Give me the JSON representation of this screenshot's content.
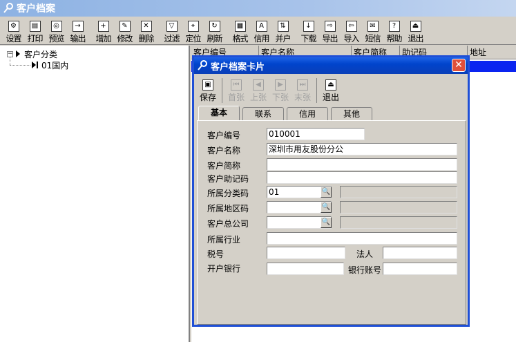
{
  "window": {
    "title": "客户档案"
  },
  "toolbar": {
    "buttons": [
      {
        "label": "设置",
        "icon": "settings-icon"
      },
      {
        "label": "打印",
        "icon": "printer-icon"
      },
      {
        "label": "预览",
        "icon": "preview-icon"
      },
      {
        "label": "输出",
        "icon": "export-icon"
      },
      {
        "label": "增加",
        "icon": "add-icon"
      },
      {
        "label": "修改",
        "icon": "edit-icon"
      },
      {
        "label": "删除",
        "icon": "delete-icon"
      },
      {
        "label": "过滤",
        "icon": "filter-icon"
      },
      {
        "label": "定位",
        "icon": "locate-icon"
      },
      {
        "label": "刷新",
        "icon": "refresh-icon"
      },
      {
        "label": "格式",
        "icon": "format-icon"
      },
      {
        "label": "信用",
        "icon": "credit-icon"
      },
      {
        "label": "并户",
        "icon": "merge-icon"
      },
      {
        "label": "下载",
        "icon": "download-icon"
      },
      {
        "label": "导出",
        "icon": "export-out-icon"
      },
      {
        "label": "导入",
        "icon": "import-icon"
      },
      {
        "label": "短信",
        "icon": "sms-icon"
      },
      {
        "label": "帮助",
        "icon": "help-icon"
      },
      {
        "label": "退出",
        "icon": "exit-icon"
      }
    ]
  },
  "tree": {
    "root": "客户分类",
    "child": "01国内"
  },
  "grid": {
    "columns": [
      "客户编号",
      "客户名称",
      "客户简称",
      "助记码",
      "地址"
    ]
  },
  "dialog": {
    "title": "客户档案卡片",
    "close_glyph": "✕",
    "toolbar": [
      {
        "label": "保存",
        "enabled": true,
        "icon": "save-icon"
      },
      {
        "label": "首张",
        "enabled": false,
        "icon": "first-icon"
      },
      {
        "label": "上张",
        "enabled": false,
        "icon": "prev-icon"
      },
      {
        "label": "下张",
        "enabled": false,
        "icon": "next-icon"
      },
      {
        "label": "末张",
        "enabled": false,
        "icon": "last-icon"
      },
      {
        "label": "退出",
        "enabled": true,
        "icon": "exit-icon"
      }
    ],
    "tabs": [
      "基本",
      "联系",
      "信用",
      "其他"
    ],
    "active_tab": "基本",
    "form": {
      "customer_code": {
        "label": "客户编号",
        "value": "010001"
      },
      "customer_name": {
        "label": "客户名称",
        "value": "深圳市用友股份分公"
      },
      "customer_short": {
        "label": "客户简称",
        "value": ""
      },
      "mnemonic": {
        "label": "客户助记码",
        "value": ""
      },
      "category_code": {
        "label": "所属分类码",
        "value": "01"
      },
      "region_code": {
        "label": "所属地区码",
        "value": ""
      },
      "head_office": {
        "label": "客户总公司",
        "value": ""
      },
      "industry": {
        "label": "所属行业",
        "value": ""
      },
      "tax_no": {
        "label": "税号",
        "value": ""
      },
      "legal_person": {
        "label": "法人",
        "value": ""
      },
      "bank": {
        "label": "开户银行",
        "value": ""
      },
      "bank_account": {
        "label": "银行账号",
        "value": ""
      }
    }
  },
  "colors": {
    "dialog_title": "#0a3fb8",
    "selection": "#0a24f0",
    "face": "#d4d0c8"
  }
}
